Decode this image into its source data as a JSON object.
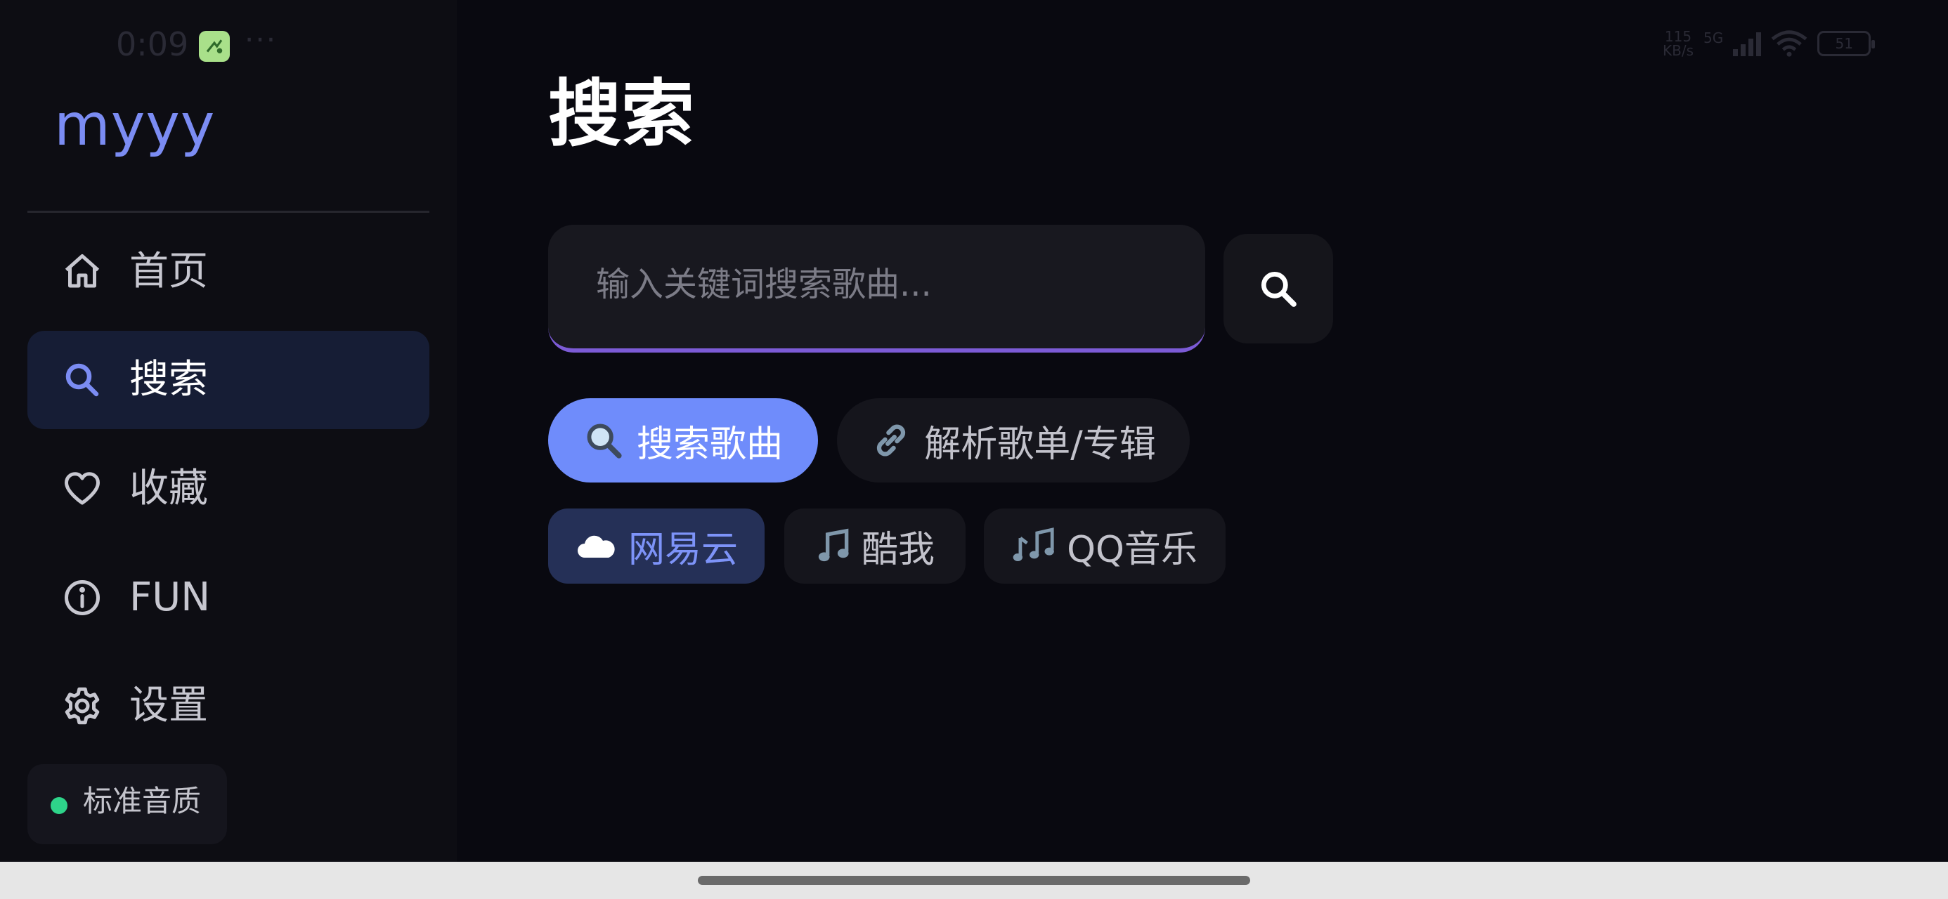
{
  "status_bar": {
    "time": "0:09",
    "more": "···",
    "net_speed_value": "115",
    "net_speed_unit": "KB/s",
    "network": "5G",
    "battery": "51"
  },
  "sidebar": {
    "logo": "myyy",
    "items": [
      {
        "label": "首页",
        "icon": "home-icon",
        "active": false
      },
      {
        "label": "搜索",
        "icon": "search-icon",
        "active": true
      },
      {
        "label": "收藏",
        "icon": "heart-icon",
        "active": false
      },
      {
        "label": "FUN",
        "icon": "info-icon",
        "active": false
      },
      {
        "label": "设置",
        "icon": "gear-icon",
        "active": false
      }
    ],
    "quality": {
      "label": "标准音质",
      "status_color": "#2ed48a"
    }
  },
  "main": {
    "title": "搜索",
    "search": {
      "placeholder": "输入关键词搜索歌曲...",
      "value": ""
    },
    "modes": [
      {
        "emoji": "🔍",
        "label": "搜索歌曲",
        "selected": true
      },
      {
        "emoji": "🔗",
        "label": "解析歌单/专辑",
        "selected": false
      }
    ],
    "sources": [
      {
        "emoji": "☁️",
        "label": "网易云",
        "selected": true
      },
      {
        "emoji": "🎵",
        "label": "酷我",
        "selected": false
      },
      {
        "emoji": "🎶",
        "label": "QQ音乐",
        "selected": false
      }
    ]
  },
  "colors": {
    "background": "#090910",
    "sidebar": "#0d0d13",
    "accent": "#6f8cfb",
    "active_nav": "#161d35",
    "input_underline": "#7c5bd6"
  }
}
